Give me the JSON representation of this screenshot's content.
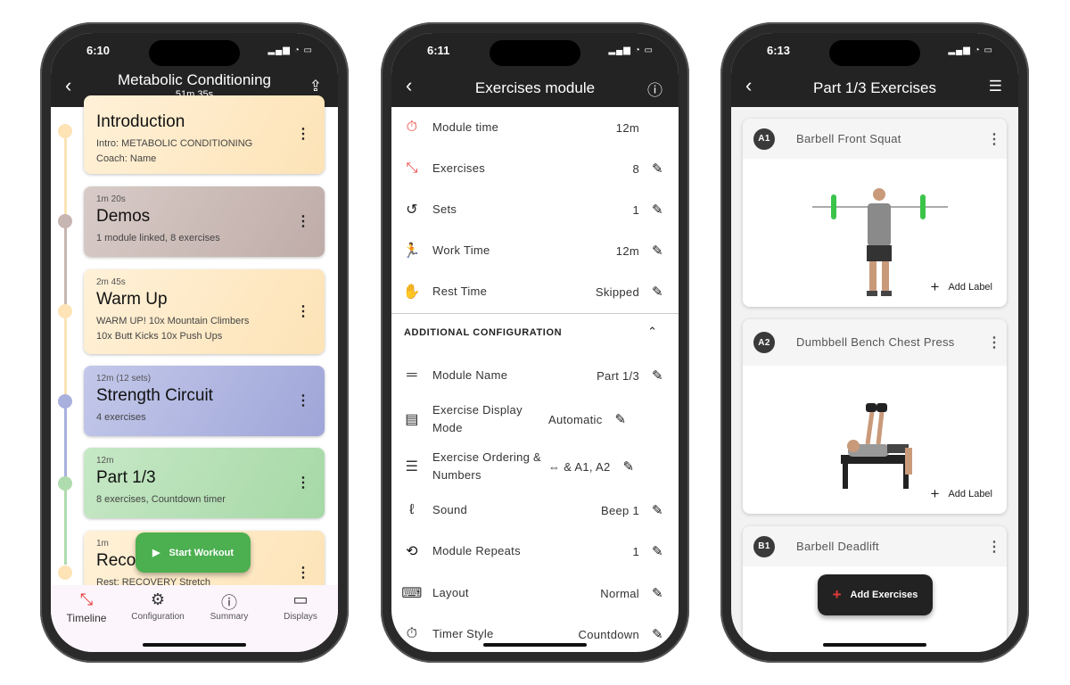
{
  "phone1": {
    "time": "6:10",
    "title": "Metabolic Conditioning",
    "subtitle": "51m 35s",
    "cards": [
      {
        "duration": "",
        "title": "Introduction",
        "subtitle": "Intro: METABOLIC CONDITIONING",
        "subtitle2": "Coach: Name",
        "color": "#fde3b6"
      },
      {
        "duration": "1m 20s",
        "title": "Demos",
        "subtitle": "1 module linked, 8 exercises",
        "subtitle2": "",
        "color": "#c7b5b1"
      },
      {
        "duration": "2m 45s",
        "title": "Warm Up",
        "subtitle": "WARM UP!  10x Mountain Climbers",
        "subtitle2": "10x Butt Kicks 10x Push Ups",
        "color": "#fde3b6"
      },
      {
        "duration": "12m (12 sets)",
        "title": "Strength Circuit",
        "subtitle": "4 exercises",
        "subtitle2": "",
        "color": "#aab0de"
      },
      {
        "duration": "12m",
        "title": "Part 1/3",
        "subtitle": "8 exercises, Countdown timer",
        "subtitle2": "",
        "color": "#aedcae"
      },
      {
        "duration": "1m",
        "title": "Recovery",
        "subtitle": "Rest: RECOVERY Stretch",
        "subtitle2": "",
        "color": "#fde3b6"
      }
    ],
    "start_button": "Start Workout",
    "nav": [
      {
        "label": "Timeline",
        "icon": "timeline-icon"
      },
      {
        "label": "Configuration",
        "icon": "gear-icon"
      },
      {
        "label": "Summary",
        "icon": "info-icon"
      },
      {
        "label": "Displays",
        "icon": "monitor-icon"
      }
    ]
  },
  "phone2": {
    "time": "6:11",
    "title": "Exercises module",
    "rows": [
      {
        "label": "Module time",
        "value": "12m",
        "icon": "timer-icon",
        "editable": false
      },
      {
        "label": "Exercises",
        "value": "8",
        "icon": "dumbbell-icon",
        "editable": true
      },
      {
        "label": "Sets",
        "value": "1",
        "icon": "repeat-icon",
        "editable": true
      },
      {
        "label": "Work Time",
        "value": "12m",
        "icon": "running-icon",
        "editable": true
      },
      {
        "label": "Rest Time",
        "value": "Skipped",
        "icon": "hand-icon",
        "editable": true
      }
    ],
    "section": "ADDITIONAL CONFIGURATION",
    "config": [
      {
        "label": "Module Name",
        "value": "Part 1/3",
        "icon": "short-text-icon"
      },
      {
        "label": "Exercise Display Mode",
        "value": "Automatic",
        "icon": "layout-icon"
      },
      {
        "label": "Exercise Ordering & Numbers",
        "value": "⇔ & A1, A2",
        "icon": "numbered-list-icon"
      },
      {
        "label": "Sound",
        "value": "Beep 1",
        "icon": "hearing-icon"
      },
      {
        "label": "Module Repeats",
        "value": "1",
        "icon": "replay-icon"
      },
      {
        "label": "Layout",
        "value": "Normal",
        "icon": "keyboard-icon"
      },
      {
        "label": "Timer Style",
        "value": "Countdown",
        "icon": "stopwatch-icon"
      }
    ]
  },
  "phone3": {
    "time": "6:13",
    "title": "Part 1/3 Exercises",
    "exercises": [
      {
        "badge": "A1",
        "name": "Barbell Front Squat"
      },
      {
        "badge": "A2",
        "name": "Dumbbell Bench Chest Press"
      },
      {
        "badge": "B1",
        "name": "Barbell Deadlift"
      }
    ],
    "add_label": "Add Label",
    "add_exercises": "Add Exercises"
  },
  "colors": {
    "header": "#232323",
    "start": "#4caf50",
    "accent_red": "#e53935"
  }
}
